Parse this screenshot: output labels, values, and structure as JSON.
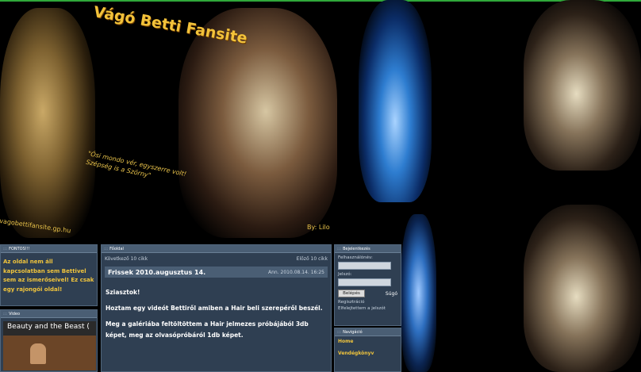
{
  "banner": {
    "site_title": "Vágó Betti Fansite",
    "quote": "\"Ósi mondo vér, egyszerre volt! Szépség is a Szörny\"",
    "url_watermark": "vagobettifansite.gp.hu",
    "credit": "By: Lilo"
  },
  "panels": {
    "important": {
      "header": "FONTOS!!!",
      "text": "Az oldal nem áll kapcsolatban sem Bettivel sem az ismerőseivel! Ez csak egy rajongói oldal!"
    },
    "video": {
      "header": "Video",
      "thumb_title": "Beauty and the Beast ("
    },
    "home": {
      "header": "Főoldal",
      "nav_next": "Következő 10 cikk",
      "nav_prev": "Előző 10 cikk",
      "post_title": "Frissek 2010.augusztus 14.",
      "post_meta": "Ann. 2010.08.14. 16:25",
      "paragraphs": [
        "Sziasztok!",
        "Hoztam egy videót Bettiről amiben a Hair beli szerepéről beszél.",
        "Meg a galériába feltöltöttem a Hair jelmezes próbájából 3db képet, meg az olvasópróbáról 1db képet."
      ]
    },
    "login": {
      "header": "Bejelentkezés",
      "username_label": "Felhasználónév:",
      "password_label": "Jelszó:",
      "button": "Belépés",
      "icon_label": "Súgó",
      "register_link": "Regisztráció",
      "forgot_link": "Elfelejtettem a jelszót"
    },
    "links": {
      "header": "Navigáció",
      "home_item": "Home",
      "guestbook_item": "Vendégkönyv"
    }
  },
  "colors": {
    "panel_bg": "#2f3f52",
    "panel_header": "#4a5e74",
    "accent_gold": "#f0c43c",
    "top_border": "#2fa83a"
  }
}
